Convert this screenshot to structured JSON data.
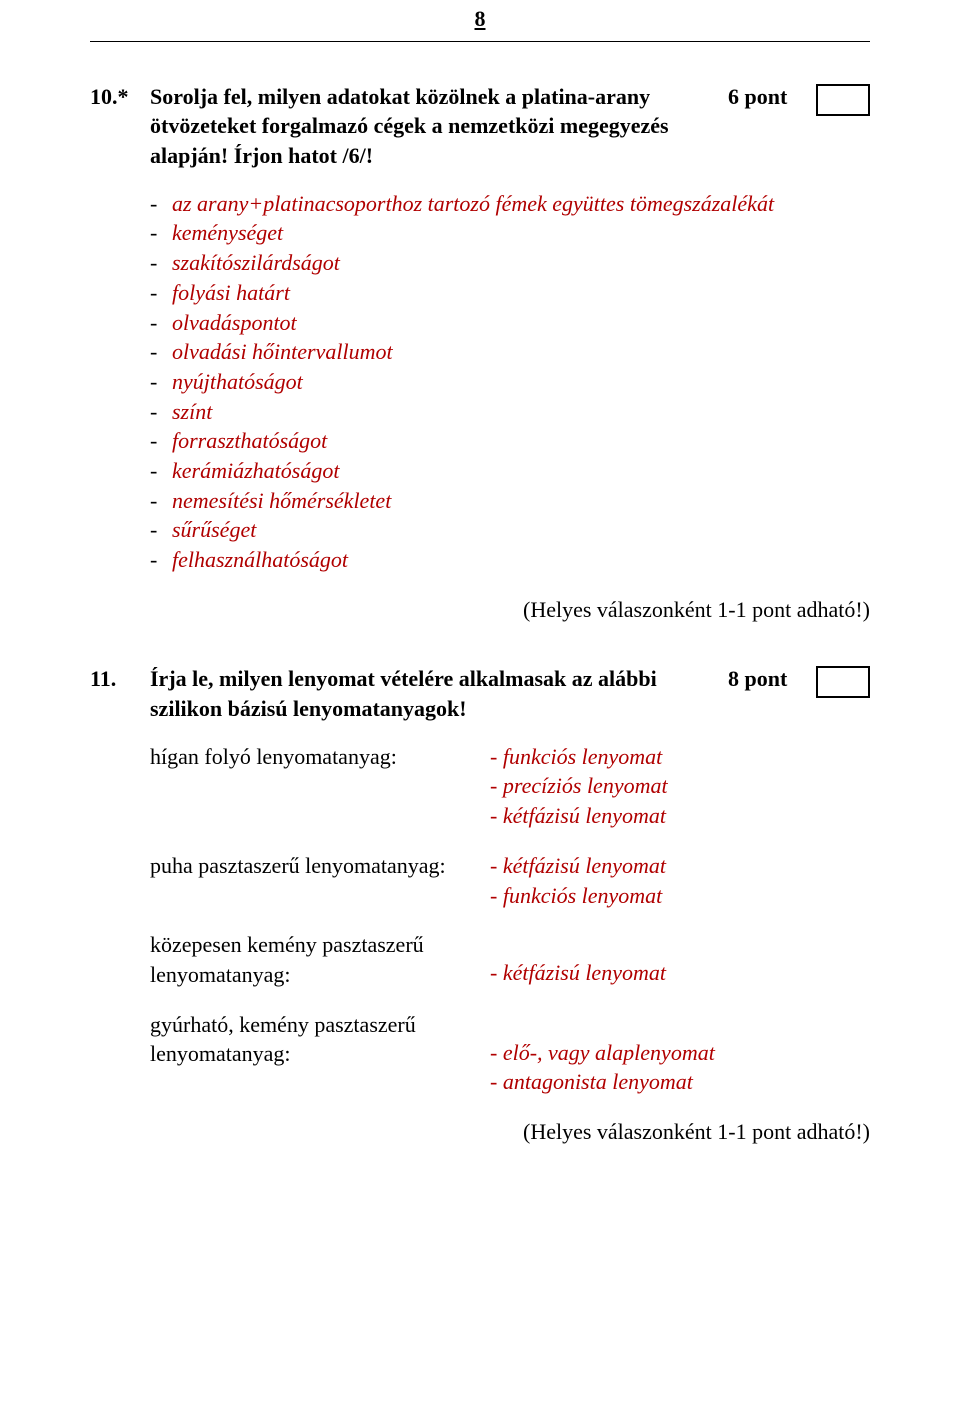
{
  "page_number": "8",
  "q10": {
    "num": "10.*",
    "text_line1": "Sorolja fel, milyen adatokat közölnek a platina-arany",
    "text_line2": "ötvözeteket forgalmazó cégek a nemzetközi megegyezés",
    "text_line3": "alapján! Írjon hatot /6/!",
    "points": "6 pont",
    "answers": [
      "az arany+platinacsoporthoz tartozó fémek együttes tömegszázalékát",
      "keménységet",
      "szakítószilárdságot",
      "folyási határt",
      "olvadáspontot",
      "olvadási hőintervallumot",
      "nyújthatóságot",
      "színt",
      "forraszthatóságot",
      "kerámiázhatóságot",
      "nemesítési hőmérsékletet",
      "sűrűséget",
      "felhasználhatóságot"
    ],
    "scoring": "(Helyes válaszonként 1-1 pont adható!)"
  },
  "q11": {
    "num": "11.",
    "text_line1": "Írja le, milyen lenyomat vételére alkalmasak az alábbi",
    "text_line2": "szilikon bázisú lenyomatanyagok!",
    "points": "8 pont",
    "pairs": [
      {
        "label": "hígan folyó lenyomatanyag:",
        "values": [
          "- funkciós  lenyomat",
          "- precíziós lenyomat",
          "- kétfázisú lenyomat"
        ]
      },
      {
        "label": "puha pasztaszerű lenyomatanyag:",
        "values": [
          "- kétfázisú  lenyomat",
          "- funkciós lenyomat"
        ]
      },
      {
        "label_line1": "közepesen kemény pasztaszerű",
        "label_line2": "lenyomatanyag:",
        "values": [
          "- kétfázisú  lenyomat"
        ]
      },
      {
        "label_line1": "gyúrható, kemény pasztaszerű",
        "label_line2": "lenyomatanyag:",
        "values": [
          "- elő-, vagy alaplenyomat",
          "- antagonista lenyomat"
        ]
      }
    ],
    "scoring": "(Helyes válaszonként 1-1 pont adható!)"
  }
}
